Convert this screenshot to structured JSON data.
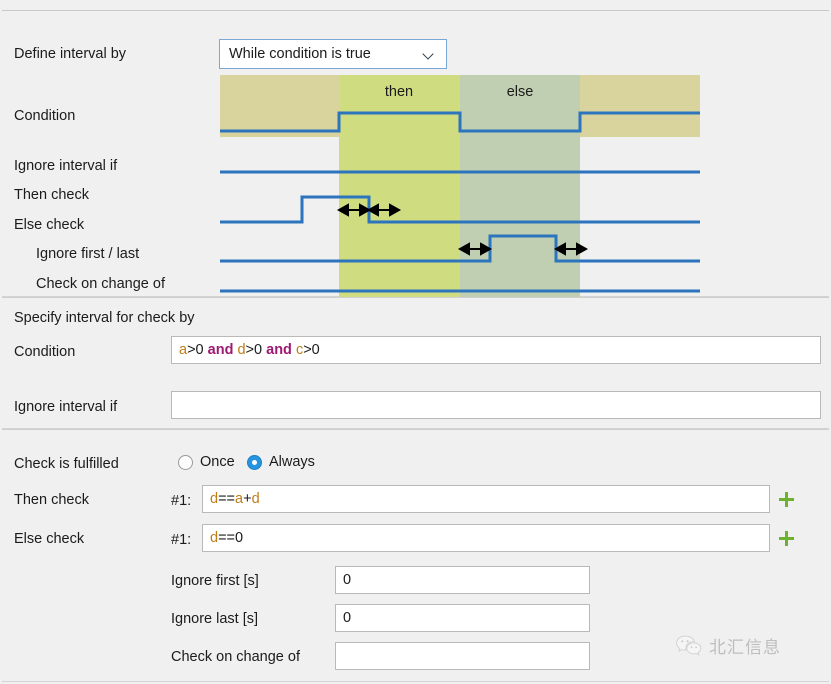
{
  "interval_section": {
    "define_interval_label": "Define interval by",
    "define_interval_value": "While condition is true",
    "condition_label": "Condition",
    "ignore_interval_label": "Ignore interval if",
    "then_check_label": "Then check",
    "else_check_label": "Else check",
    "ignore_first_last_label": "Ignore first / last",
    "check_on_change_label": "Check on change of",
    "diagram": {
      "then_band_label": "then",
      "else_band_label": "else",
      "colors": {
        "khaki": "#d9d49d",
        "then": "#cfdd80",
        "else": "#c0cfb1",
        "signal_blue": "#2c74bd",
        "arrow_black": "#000000"
      }
    }
  },
  "specify_section": {
    "title": "Specify interval for check by",
    "condition_label": "Condition",
    "condition_expression": {
      "tokens": [
        {
          "text": "a",
          "kind": "var"
        },
        {
          "text": ">",
          "kind": "op"
        },
        {
          "text": "0",
          "kind": "num"
        },
        {
          "text": " ",
          "kind": "op"
        },
        {
          "text": "and",
          "kind": "kw"
        },
        {
          "text": " ",
          "kind": "op"
        },
        {
          "text": "d",
          "kind": "var"
        },
        {
          "text": ">",
          "kind": "op"
        },
        {
          "text": "0",
          "kind": "num"
        },
        {
          "text": " ",
          "kind": "op"
        },
        {
          "text": "and",
          "kind": "kw"
        },
        {
          "text": " ",
          "kind": "op"
        },
        {
          "text": "c",
          "kind": "var"
        },
        {
          "text": ">",
          "kind": "op"
        },
        {
          "text": "0",
          "kind": "num"
        }
      ],
      "plain": "a>0 and d>0 and c>0"
    },
    "ignore_interval_label": "Ignore interval if",
    "ignore_interval_value": ""
  },
  "checks_section": {
    "check_fulfilled_label": "Check is fulfilled",
    "radio_once_label": "Once",
    "radio_always_label": "Always",
    "radio_selected": "Always",
    "then_check_label": "Then check",
    "then_check_index": "#1:",
    "then_check_expression": {
      "tokens": [
        {
          "text": "d",
          "kind": "var"
        },
        {
          "text": "==",
          "kind": "op"
        },
        {
          "text": "a",
          "kind": "var"
        },
        {
          "text": "+",
          "kind": "op"
        },
        {
          "text": "d",
          "kind": "var"
        }
      ],
      "plain": "d==a+d"
    },
    "else_check_label": "Else check",
    "else_check_index": "#1:",
    "else_check_expression": {
      "tokens": [
        {
          "text": "d",
          "kind": "var"
        },
        {
          "text": "==",
          "kind": "op"
        },
        {
          "text": "0",
          "kind": "num"
        }
      ],
      "plain": "d==0"
    },
    "add_then_button": "+",
    "add_else_button": "+",
    "ignore_first_label": "Ignore first [s]",
    "ignore_first_value": "0",
    "ignore_last_label": "Ignore last [s]",
    "ignore_last_value": "0",
    "check_on_change_label": "Check on change of",
    "check_on_change_value": ""
  },
  "watermark": {
    "text": "北汇信息",
    "icon": "wechat-icon"
  }
}
